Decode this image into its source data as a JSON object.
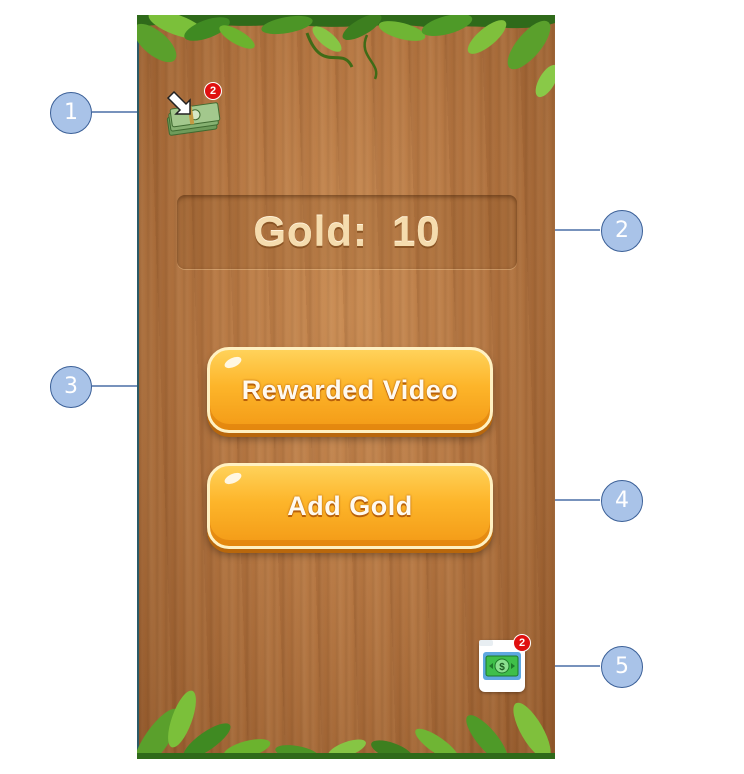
{
  "game": {
    "gold_label": "Gold:",
    "gold_value": "10",
    "buttons": {
      "rewarded_video": "Rewarded Video",
      "add_gold": "Add Gold"
    },
    "top_icon": {
      "name": "money-stack-icon",
      "badge": "2"
    },
    "bottom_icon": {
      "name": "cash-bill-icon",
      "badge": "2"
    }
  },
  "annotations": [
    "1",
    "2",
    "3",
    "4",
    "5"
  ],
  "colors": {
    "wood": "#b47540",
    "button_orange": "#fdb52a",
    "gold_text": "#f5dcae",
    "badge_red": "#e01010",
    "annotation_fill": "#a9c3e8",
    "annotation_border": "#3a5f97"
  }
}
